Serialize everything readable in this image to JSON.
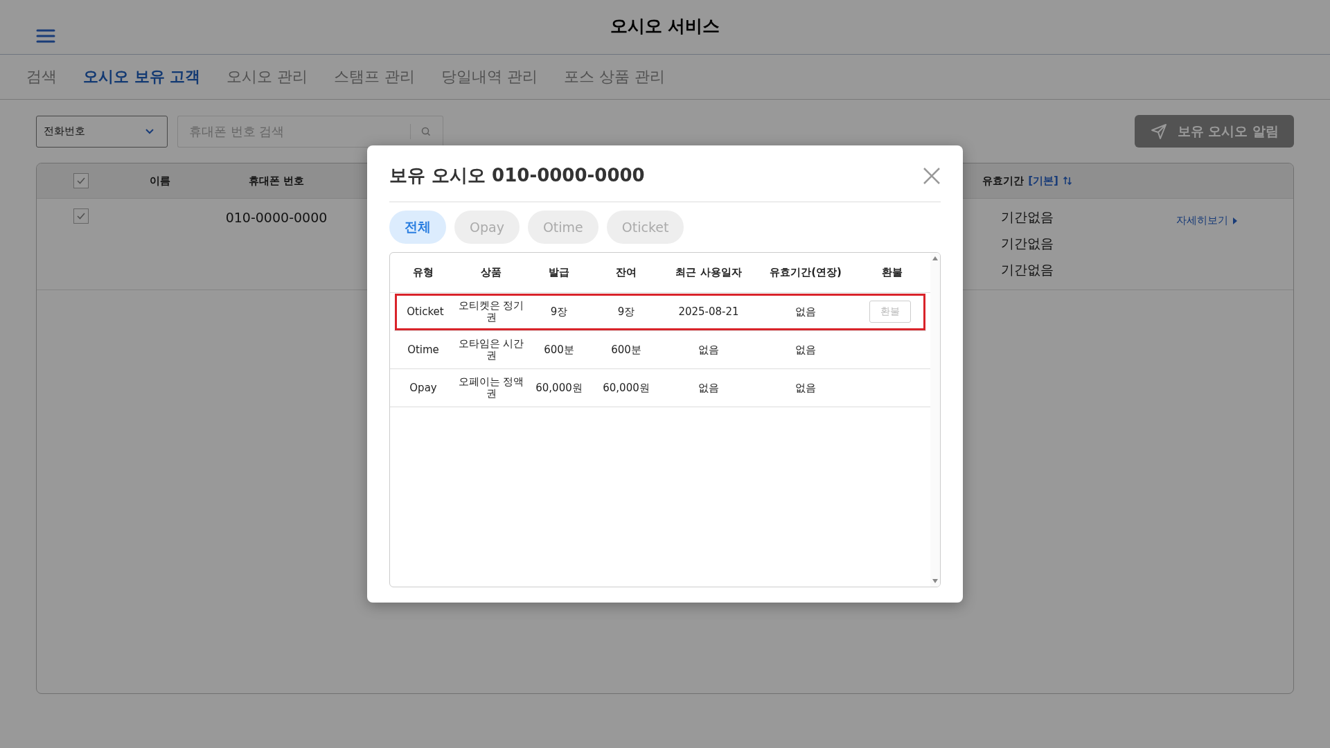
{
  "header": {
    "title": "오시오 서비스"
  },
  "tabs": [
    {
      "label": "검색",
      "selected": false
    },
    {
      "label": "오시오 보유 고객",
      "selected": true
    },
    {
      "label": "오시오 관리",
      "selected": false
    },
    {
      "label": "스탬프 관리",
      "selected": false
    },
    {
      "label": "당일내역 관리",
      "selected": false
    },
    {
      "label": "포스 상품 관리",
      "selected": false
    }
  ],
  "toolbar": {
    "filter": "전화번호",
    "search": {
      "placeholder": "휴대폰 번호 검색"
    },
    "notify_button": "보유 오시오 알림",
    "notify_disabled": true
  },
  "table": {
    "header_checked": true,
    "columns": {
      "name": "이름",
      "phone": "휴대폰 번호",
      "expiry": "유효기간",
      "expiry_mode": "[기본]"
    },
    "rows": [
      {
        "checked": true,
        "phone": "010-0000-0000",
        "expiry": [
          "기간없음",
          "기간없음",
          "기간없음"
        ],
        "detail_link": "자세히보기"
      }
    ]
  },
  "modal": {
    "title": "보유 오시오 010-0000-0000",
    "filters": [
      {
        "label": "전체",
        "selected": true
      },
      {
        "label": "Opay",
        "selected": false
      },
      {
        "label": "Otime",
        "selected": false
      },
      {
        "label": "Oticket",
        "selected": false
      }
    ],
    "columns": [
      "유형",
      "상품",
      "발급",
      "잔여",
      "최근 사용일자",
      "유효기간(연장)",
      "환불"
    ],
    "rows": [
      {
        "type": "Oticket",
        "product": "오티켓은 정기권",
        "issued": "9장",
        "remaining": "9장",
        "last_used": "2025-08-21",
        "expiry": "없음",
        "refund": "환불",
        "highlighted": true
      },
      {
        "type": "Otime",
        "product": "오타임은 시간권",
        "issued": "600분",
        "remaining": "600분",
        "last_used": "없음",
        "expiry": "없음",
        "highlighted": false
      },
      {
        "type": "Opay",
        "product": "오페이는 정액권",
        "issued": "60,000원",
        "remaining": "60,000원",
        "last_used": "없음",
        "expiry": "없음",
        "highlighted": false
      }
    ]
  }
}
